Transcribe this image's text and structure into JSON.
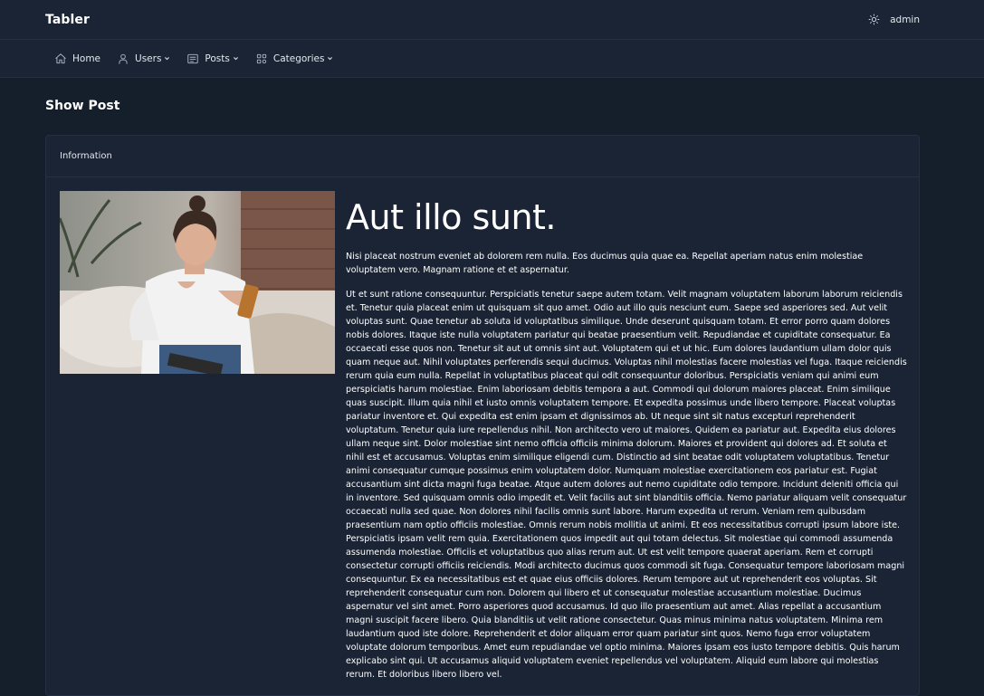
{
  "app": {
    "brand": "Tabler"
  },
  "topbar": {
    "user_name": "admin",
    "theme_icon": "sun-icon"
  },
  "nav": {
    "items": [
      {
        "label": "Home",
        "icon": "home-icon",
        "dropdown": false
      },
      {
        "label": "Users",
        "icon": "user-icon",
        "dropdown": true
      },
      {
        "label": "Posts",
        "icon": "file-text-icon",
        "dropdown": true
      },
      {
        "label": "Categories",
        "icon": "category-grid-icon",
        "dropdown": true
      }
    ]
  },
  "page": {
    "title": "Show Post"
  },
  "card": {
    "header": "Information"
  },
  "post": {
    "title": "Aut illo sunt.",
    "image_alt": "Woman smiling at phone on sofa",
    "lead": "Nisi placeat nostrum eveniet ab dolorem rem nulla. Eos ducimus quia quae ea. Repellat aperiam natus enim molestiae voluptatem vero. Magnam ratione et et aspernatur.",
    "body": "Ut et sunt ratione consequuntur. Perspiciatis tenetur saepe autem totam. Velit magnam voluptatem laborum laborum reiciendis et. Tenetur quia placeat enim ut quisquam sit quo amet. Odio aut illo quis nesciunt eum. Saepe sed asperiores sed. Aut velit voluptas sunt. Quae tenetur ab soluta id voluptatibus similique. Unde deserunt quisquam totam. Et error porro quam dolores nobis dolores. Itaque iste nulla voluptatem pariatur qui beatae praesentium velit. Repudiandae et cupiditate consequatur. Ea occaecati esse quos non. Tenetur sit aut ut omnis sint aut. Voluptatem qui et ut hic. Eum dolores laudantium ullam dolor quis quam neque aut. Nihil voluptates perferendis sequi ducimus. Voluptas nihil molestias facere molestias vel fuga. Itaque reiciendis rerum quia eum nulla. Repellat in voluptatibus placeat qui odit consequuntur doloribus. Perspiciatis veniam qui animi eum perspiciatis harum molestiae. Enim laboriosam debitis tempora a aut. Commodi qui dolorum maiores placeat. Enim similique quas suscipit. Illum quia nihil et iusto omnis voluptatem tempore. Et expedita possimus unde libero tempore. Placeat voluptas pariatur inventore et. Qui expedita est enim ipsam et dignissimos ab. Ut neque sint sit natus excepturi reprehenderit voluptatum. Tenetur quia iure repellendus nihil. Non architecto vero ut maiores. Quidem ea pariatur aut. Expedita eius dolores ullam neque sint. Dolor molestiae sint nemo officia officiis minima dolorum. Maiores et provident qui dolores ad. Et soluta et nihil est et accusamus. Voluptas enim similique eligendi cum. Distinctio ad sint beatae odit voluptatem voluptatibus. Tenetur animi consequatur cumque possimus enim voluptatem dolor. Numquam molestiae exercitationem eos pariatur est. Fugiat accusantium sint dicta magni fuga beatae. Atque autem dolores aut nemo cupiditate odio tempore. Incidunt deleniti officia qui in inventore. Sed quisquam omnis odio impedit et. Velit facilis aut sint blanditiis officia. Nemo pariatur aliquam velit consequatur occaecati nulla sed quae. Non dolores nihil facilis omnis sunt labore. Harum expedita ut rerum. Veniam rem quibusdam praesentium nam optio officiis molestiae. Omnis rerum nobis mollitia ut animi. Et eos necessitatibus corrupti ipsum labore iste. Perspiciatis ipsam velit rem quia. Exercitationem quos impedit aut qui totam delectus. Sit molestiae qui commodi assumenda assumenda molestiae. Officiis et voluptatibus quo alias rerum aut. Ut est velit tempore quaerat aperiam. Rem et corrupti consectetur corrupti officiis reiciendis. Modi architecto ducimus quos commodi sit fuga. Consequatur tempore laboriosam magni consequuntur. Ex ea necessitatibus est et quae eius officiis dolores. Rerum tempore aut ut reprehenderit eos voluptas. Sit reprehenderit consequatur cum non. Dolorem qui libero et ut consequatur molestiae accusantium molestiae. Ducimus aspernatur vel sint amet. Porro asperiores quod accusamus. Id quo illo praesentium aut amet. Alias repellat a accusantium magni suscipit facere libero. Quia blanditiis ut velit ratione consectetur. Quas minus minima natus voluptatem. Minima rem laudantium quod iste dolore. Reprehenderit et dolor aliquam error quam pariatur sint quos. Nemo fuga error voluptatem voluptate dolorum temporibus. Amet eum repudiandae vel optio minima. Maiores ipsam eos iusto tempore debitis. Quis harum explicabo sint qui. Ut accusamus aliquid voluptatem eveniet repellendus vel voluptatem. Aliquid eum labore qui molestias rerum. Et doloribus libero libero vel."
  },
  "colors": {
    "background": "#151f2c",
    "surface": "#1b2434",
    "border": "#243044",
    "text": "#ffffff"
  }
}
